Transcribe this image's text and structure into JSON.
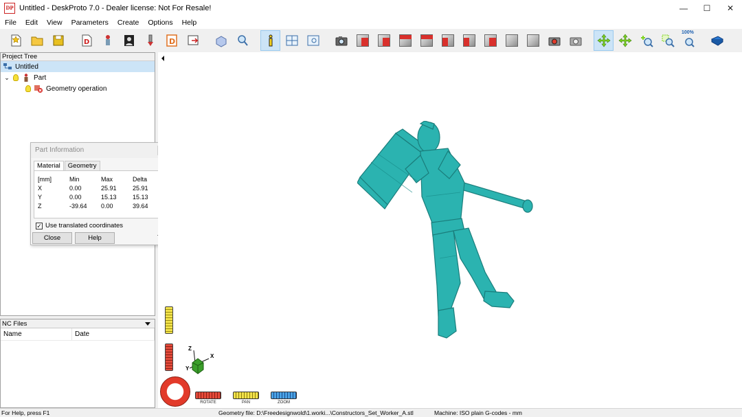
{
  "window": {
    "title": "Untitled - DeskProto 7.0 - Dealer license: Not For Resale!",
    "logo_text": "DP",
    "controls": [
      "—",
      "☐",
      "✕"
    ]
  },
  "menu": [
    "File",
    "Edit",
    "View",
    "Parameters",
    "Create",
    "Options",
    "Help"
  ],
  "toolbar": {
    "zoom_label": "100%"
  },
  "project_tree": {
    "header": "Project Tree",
    "items": [
      {
        "label": "Untitled",
        "level": 0
      },
      {
        "label": "Part",
        "level": 1
      },
      {
        "label": "Geometry operation",
        "level": 2
      }
    ]
  },
  "part_info": {
    "title": "Part Information",
    "tabs": [
      "Material",
      "Geometry"
    ],
    "active_tab": "Material",
    "columns": [
      "[mm]",
      "Min",
      "Max",
      "Delta"
    ],
    "rows": [
      [
        "X",
        "0.00",
        "25.91",
        "25.91"
      ],
      [
        "Y",
        "0.00",
        "15.13",
        "15.13"
      ],
      [
        "Z",
        "-39.64",
        "0.00",
        "39.64"
      ]
    ],
    "checkbox_label": "Use translated coordinates",
    "checkbox_checked": true,
    "close_label": "Close",
    "help_label": "Help"
  },
  "nc_files": {
    "header": "NC Files",
    "columns": [
      "Name",
      "Date"
    ]
  },
  "viewport": {
    "controls": {
      "rotate_label": "ROTATE",
      "pan_label": "PAN",
      "zoom_label": "ZOOM"
    },
    "axes": {
      "x": "X",
      "y": "Y",
      "z": "Z"
    },
    "model_color": "#2bb3b0"
  },
  "statusbar": {
    "help": "For Help, press F1",
    "geometry": "Geometry file: D:\\Freedesignwold\\1.worki...\\Constructors_Set_Worker_A.stl",
    "machine": "Machine: ISO plain G-codes - mm"
  }
}
